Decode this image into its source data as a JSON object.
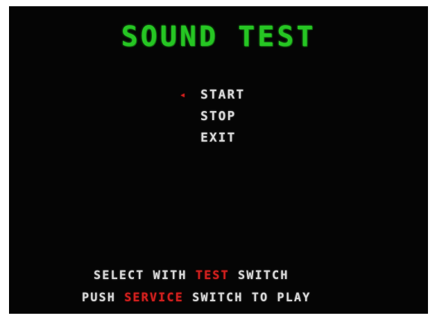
{
  "screen": {
    "title": "SOUND TEST",
    "title_color": "#26c623",
    "cursor_glyph": "◂",
    "cursor_color": "#d1201e",
    "menu": {
      "items": [
        {
          "label": "START",
          "selected": true
        },
        {
          "label": "STOP",
          "selected": false
        },
        {
          "label": "EXIT",
          "selected": false
        }
      ]
    },
    "instructions": {
      "line1": {
        "before": "SELECT WITH ",
        "highlight": "TEST",
        "after": " SWITCH"
      },
      "line2": {
        "before": "PUSH ",
        "highlight": "SERVICE",
        "after": " SWITCH TO PLAY"
      }
    },
    "text_color": "#d9d9d9",
    "background_color": "#050505"
  }
}
